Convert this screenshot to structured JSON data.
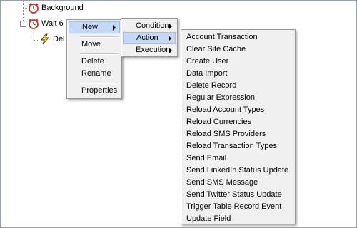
{
  "tree": {
    "nodes": [
      {
        "label": "Background"
      },
      {
        "label": "Wait 6",
        "expander": "−"
      },
      {
        "label": "Del"
      }
    ]
  },
  "context_menu": {
    "items": [
      "New",
      "Move",
      "Delete",
      "Rename",
      "Properties"
    ]
  },
  "new_submenu": {
    "items": [
      "Condition",
      "Action",
      "Execution"
    ]
  },
  "action_submenu": {
    "items": [
      "Account Transaction",
      "Clear Site Cache",
      "Create User",
      "Data Import",
      "Delete Record",
      "Regular Expression",
      "Reload Account Types",
      "Reload Currencies",
      "Reload SMS Providers",
      "Reload Transaction Types",
      "Send Email",
      "Send LinkedIn Status Update",
      "Send SMS Message",
      "Send Twitter Status Update",
      "Trigger Table Record Event",
      "Update Field"
    ]
  },
  "colors": {
    "menu_bg": "#f0f0f0",
    "highlight": "#c5d9f7",
    "clock_red": "#c0392b",
    "bolt_yellow": "#f5d000"
  }
}
